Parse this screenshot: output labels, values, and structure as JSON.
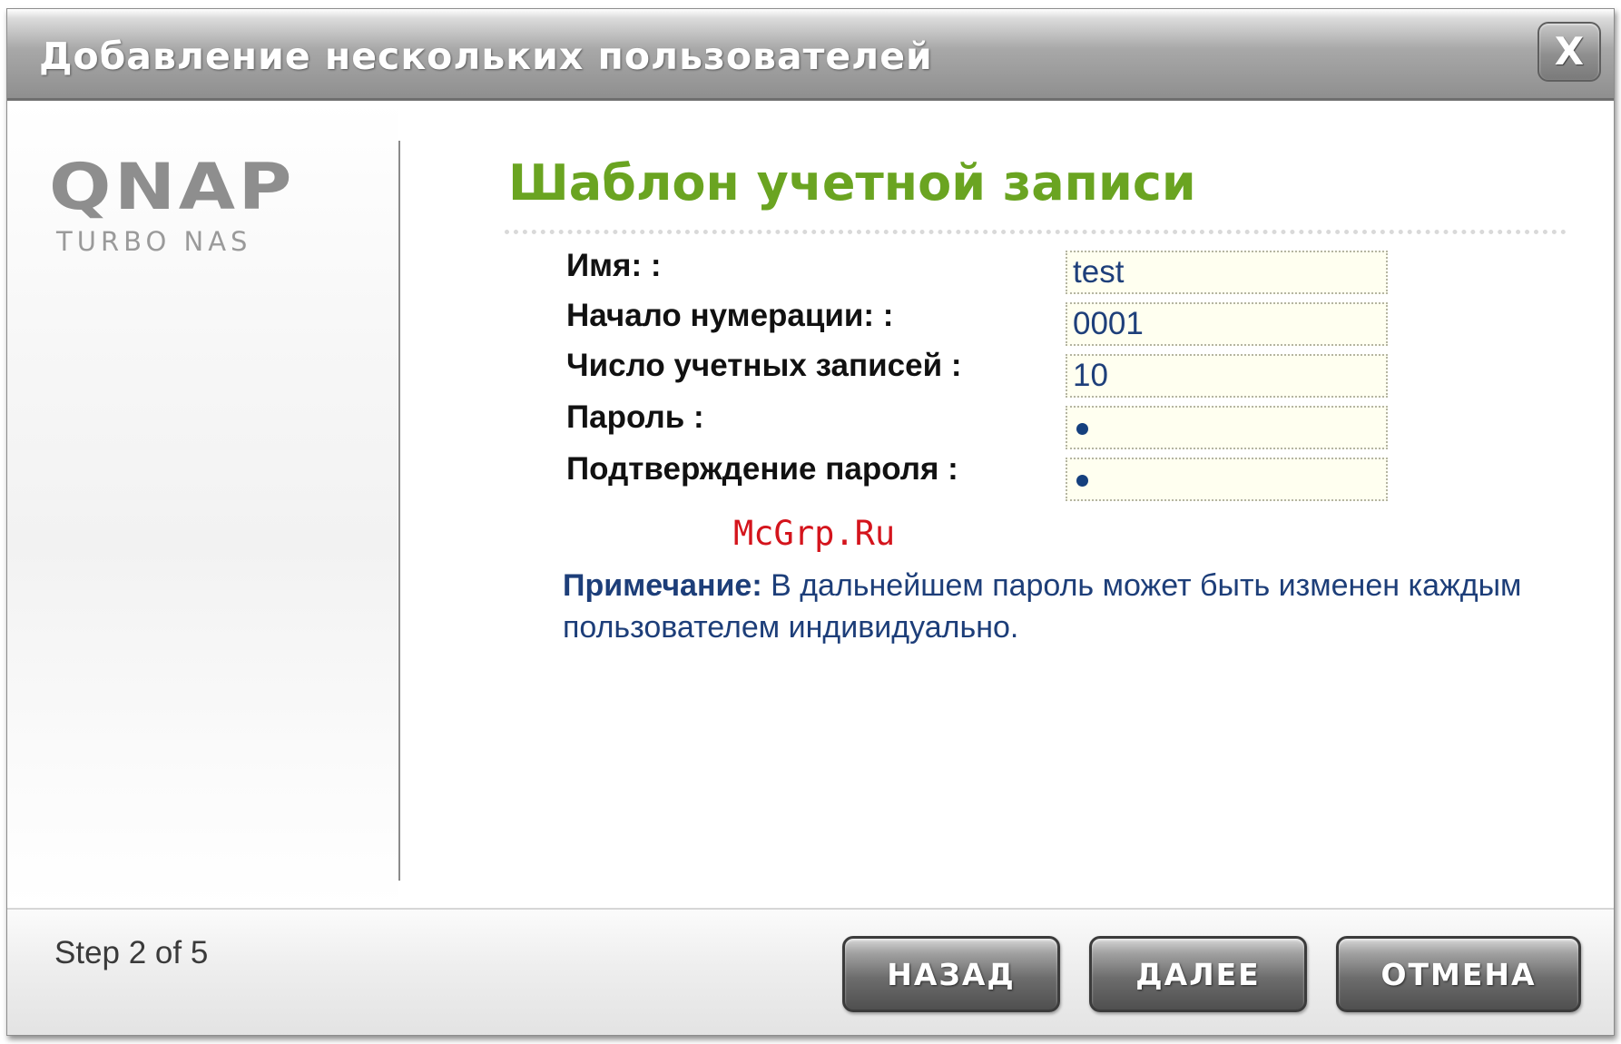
{
  "window": {
    "title": "Добавление нескольких пользователей",
    "close_glyph": "X"
  },
  "logo": {
    "brand": "QNAP",
    "subtitle": "TURBO NAS"
  },
  "content": {
    "heading": "Шаблон учетной записи",
    "fields": [
      {
        "label": "Имя:  :",
        "value": "test",
        "type": "text"
      },
      {
        "label": "Начало нумерации:  :",
        "value": "0001",
        "type": "text"
      },
      {
        "label": "Число учетных записей  :",
        "value": "10",
        "type": "text"
      },
      {
        "label": "Пароль  :",
        "value": "•",
        "type": "password"
      },
      {
        "label": "Подтверждение пароля  :",
        "value": "•",
        "type": "password"
      }
    ],
    "watermark": "McGrp.Ru",
    "note": {
      "label": "Примечание:",
      "text": " В дальнейшем пароль может быть изменен каждым пользователем индивидуально."
    }
  },
  "footer": {
    "step": "Step 2 of 5",
    "buttons": {
      "back": "НАЗАД",
      "next": "ДАЛЕЕ",
      "cancel": "ОТМЕНА"
    }
  },
  "colors": {
    "heading": "#6aa421",
    "input_text": "#1e3f7a",
    "input_bg": "#fffff0",
    "watermark": "#d4141c",
    "note_text": "#1d3e79"
  }
}
